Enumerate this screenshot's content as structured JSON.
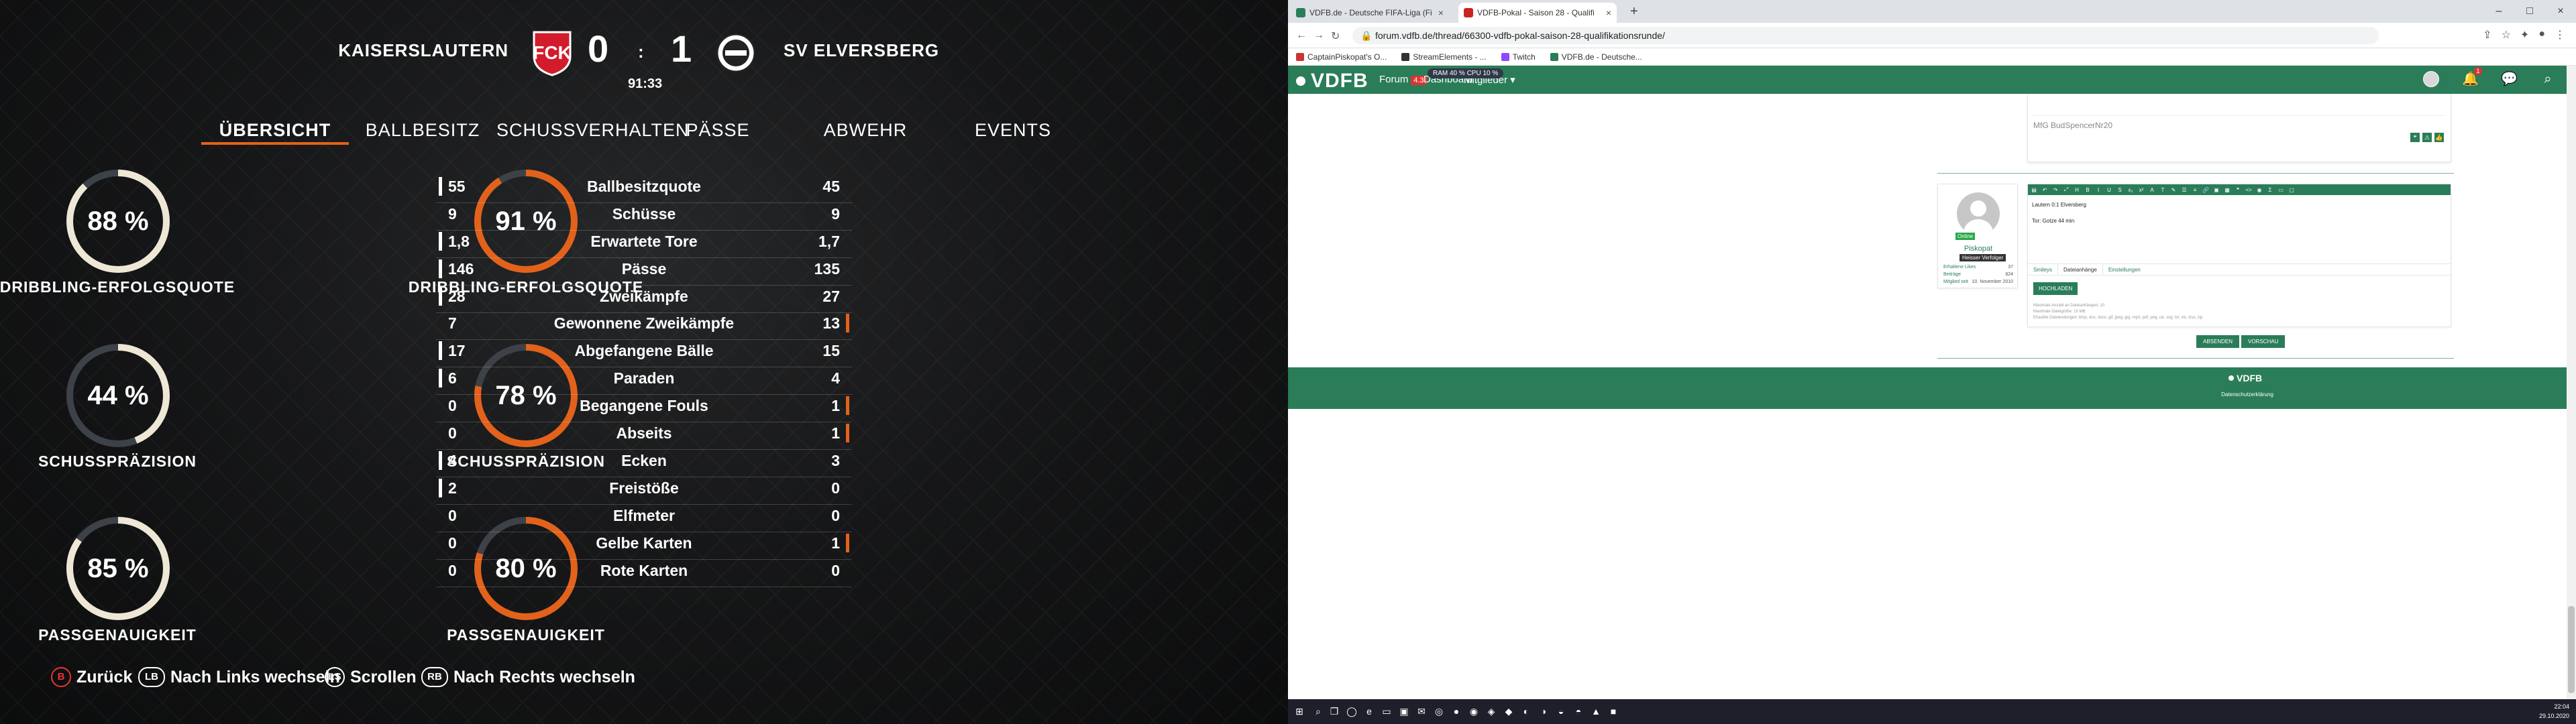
{
  "game": {
    "home_team": "KAISERSLAUTERN",
    "away_team": "SV ELVERSBERG",
    "home_score": "0",
    "away_score": "1",
    "score_sep": ":",
    "clock": "91:33",
    "tabs": [
      "ÜBERSICHT",
      "BALLBESITZ",
      "SCHUSSVERHALTEN",
      "PÄSSE",
      "ABWEHR",
      "EVENTS"
    ],
    "active_tab": "ÜBERSICHT",
    "home_gauges": [
      {
        "value": "88 %",
        "pct": 88,
        "label": "DRIBBLING-ERFOLGSQUOTE"
      },
      {
        "value": "44 %",
        "pct": 44,
        "label": "SCHUSSPRÄZISION"
      },
      {
        "value": "85 %",
        "pct": 85,
        "label": "PASSGENAUIGKEIT"
      }
    ],
    "away_gauges": [
      {
        "value": "91 %",
        "pct": 91,
        "label": "DRIBBLING-ERFOLGSQUOTE"
      },
      {
        "value": "78 %",
        "pct": 78,
        "label": "SCHUSSPRÄZISION"
      },
      {
        "value": "80 %",
        "pct": 80,
        "label": "PASSGENAUIGKEIT"
      }
    ],
    "stats": [
      {
        "name": "Ballbesitzquote",
        "home": "55",
        "away": "45",
        "lead": "home"
      },
      {
        "name": "Schüsse",
        "home": "9",
        "away": "9",
        "lead": "none"
      },
      {
        "name": "Erwartete Tore",
        "home": "1,8",
        "away": "1,7",
        "lead": "home"
      },
      {
        "name": "Pässe",
        "home": "146",
        "away": "135",
        "lead": "home"
      },
      {
        "name": "Zweikämpfe",
        "home": "28",
        "away": "27",
        "lead": "home"
      },
      {
        "name": "Gewonnene Zweikämpfe",
        "home": "7",
        "away": "13",
        "lead": "away"
      },
      {
        "name": "Abgefangene Bälle",
        "home": "17",
        "away": "15",
        "lead": "home"
      },
      {
        "name": "Paraden",
        "home": "6",
        "away": "4",
        "lead": "home"
      },
      {
        "name": "Begangene Fouls",
        "home": "0",
        "away": "1",
        "lead": "away"
      },
      {
        "name": "Abseits",
        "home": "0",
        "away": "1",
        "lead": "away"
      },
      {
        "name": "Ecken",
        "home": "4",
        "away": "3",
        "lead": "home"
      },
      {
        "name": "Freistöße",
        "home": "2",
        "away": "0",
        "lead": "home"
      },
      {
        "name": "Elfmeter",
        "home": "0",
        "away": "0",
        "lead": "none"
      },
      {
        "name": "Gelbe Karten",
        "home": "0",
        "away": "1",
        "lead": "away"
      },
      {
        "name": "Rote Karten",
        "home": "0",
        "away": "0",
        "lead": "none"
      }
    ],
    "controls": [
      {
        "btn": "B",
        "label": "Zurück"
      },
      {
        "btn": "LB",
        "label": "Nach Links wechseln"
      },
      {
        "btn": "LS",
        "label": "Scrollen"
      },
      {
        "btn": "RB",
        "label": "Nach Rechts wechseln"
      }
    ],
    "colors": {
      "accent": "#e2621b",
      "home_bar": "#ffffff",
      "ring_track": "#3c4247",
      "ring_home": "#efe7d6"
    }
  },
  "browser": {
    "tabs": [
      {
        "title": "VDFB.de - Deutsche FIFA-Liga (Fi"
      },
      {
        "title": "VDFB-Pokal - Saison 28 - Qualifi"
      }
    ],
    "url": "forum.vdfb.de/thread/66300-vdfb-pokal-saison-28-qualifikationsrunde/",
    "bookmarks": [
      "CaptainPiskopat's O...",
      "StreamElements - ...",
      "Twitch",
      "VDFB.de - Deutsche..."
    ],
    "site": {
      "logo": "VDFB",
      "menu_forum": "Forum",
      "forum_badge": "4.3",
      "menu_dashboard": "Dashboard",
      "menu_members": "Mitglieder",
      "ram_overlay": "RAM 40 %   CPU 10 %",
      "notification_count": "1",
      "prev_signature": "MfG BudSpencerNr20",
      "user": {
        "status": "Online",
        "name": "Piskopat",
        "rank": "Heisser Verfolger",
        "likes_label": "Erhaltene Likes",
        "likes": "37",
        "posts_label": "Beiträge",
        "posts": "824",
        "member_label": "Mitglied seit",
        "member_since": "10. November 2010"
      },
      "editor_line1": "Lautern 0:1 Elversberg",
      "editor_line2": "Tor: Gotze 44 min",
      "editor_tabs": [
        "Smileys",
        "Dateianhänge",
        "Einstellungen"
      ],
      "upload_label": "HOCHLADEN",
      "upload_info1": "Maximale Anzahl an Dateianhängen: 10",
      "upload_info2": "Maximale Dateigröße: 10 MB",
      "upload_info3": "Erlaubte Dateiendungen: bmp, doc, docx, gif, jpeg, jpg, mp3, pdf, png, rar, svg, txt, xls, xlsx, zip",
      "submit_label": "ABSENDEN",
      "preview_label": "VORSCHAU",
      "footer_logo": "VDFB",
      "footer_link": "Datenschutzerklärung"
    },
    "taskbar": {
      "time": "22:04",
      "date": "29.10.2020"
    }
  }
}
